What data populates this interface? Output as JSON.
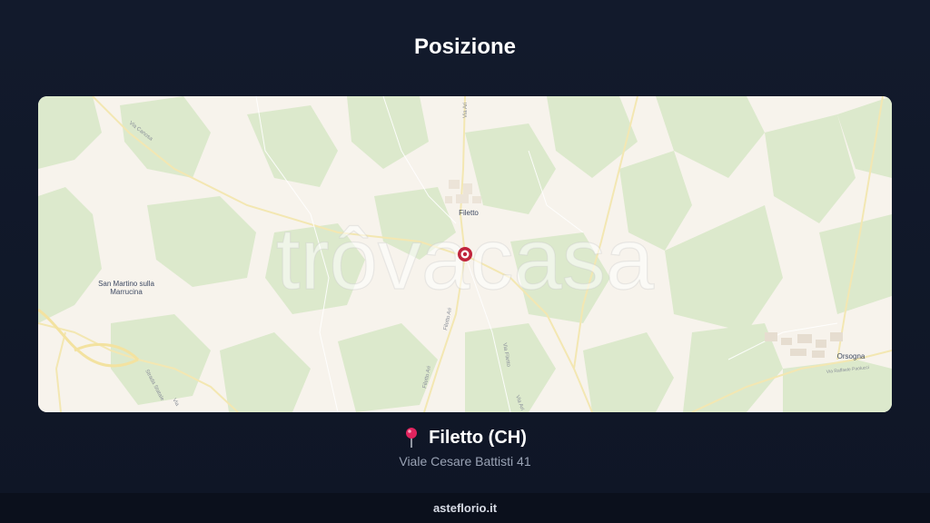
{
  "page": {
    "title": "Posizione"
  },
  "map": {
    "watermark": "trôvacasa",
    "places": {
      "filetto": "Filetto",
      "san_martino_line1": "San Martino sulla",
      "san_martino_line2": "Marrucina",
      "orsogna": "Orsogna"
    },
    "roads": {
      "via_canosa": "Via Canosa",
      "via_ari_top": "Via Ari",
      "filetto_ari_1": "Filetto Ari",
      "filetto_ari_2": "Filetto Ari",
      "via_filetto": "Via Filetto",
      "strada_statale": "Strada Statale",
      "via_raffaele": "Via Raffaele Paolucci",
      "via_bottom": "Via",
      "via_ari_right": "Via Ari"
    },
    "colors": {
      "land": "#f7f3ec",
      "green": "#dce9cc",
      "road": "#f3e7b2",
      "marker": "#c0243c"
    }
  },
  "location": {
    "icon": "map-pin-icon",
    "name": "Filetto (CH)",
    "address": "Viale Cesare Battisti 41"
  },
  "footer": {
    "site": "asteflorio.it"
  }
}
